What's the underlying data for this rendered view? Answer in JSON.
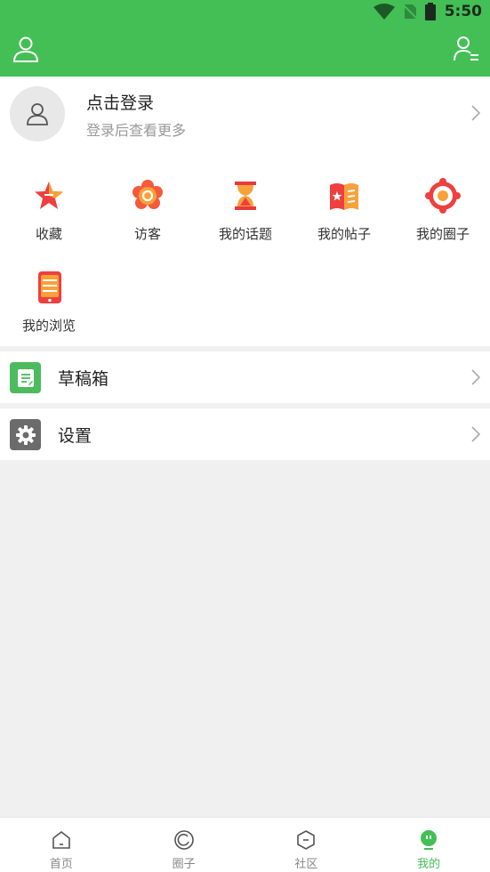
{
  "status": {
    "time": "5:50"
  },
  "colors": {
    "brand": "#43bf55",
    "text": "#222222",
    "muted": "#999999"
  },
  "profile": {
    "title": "点击登录",
    "subtitle": "登录后查看更多"
  },
  "shortcuts": [
    {
      "label": "收藏",
      "icon": "star-icon"
    },
    {
      "label": "访客",
      "icon": "flower-icon"
    },
    {
      "label": "我的话题",
      "icon": "hourglass-icon"
    },
    {
      "label": "我的帖子",
      "icon": "book-icon"
    },
    {
      "label": "我的圈子",
      "icon": "gear-flower-icon"
    },
    {
      "label": "我的浏览",
      "icon": "phone-icon"
    }
  ],
  "menu": {
    "drafts": "草稿箱",
    "settings": "设置"
  },
  "tabs": [
    {
      "label": "首页",
      "icon": "home-icon"
    },
    {
      "label": "圈子",
      "icon": "circle-icon"
    },
    {
      "label": "社区",
      "icon": "hexagon-icon"
    },
    {
      "label": "我的",
      "icon": "me-icon"
    }
  ]
}
